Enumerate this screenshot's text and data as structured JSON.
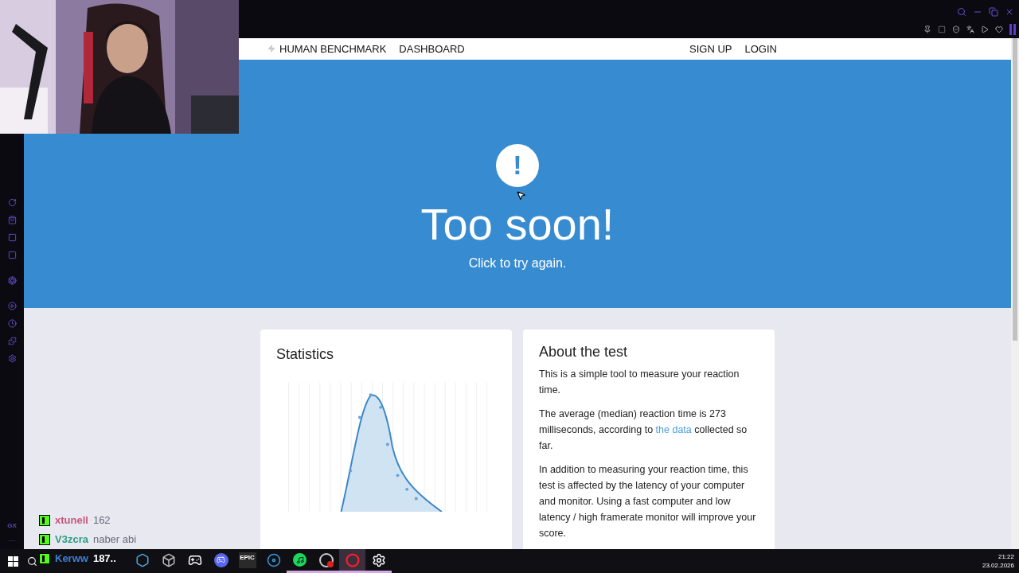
{
  "nav": {
    "brand": "HUMAN BENCHMARK",
    "links": [
      "DASHBOARD"
    ],
    "account": [
      "SIGN UP",
      "LOGIN"
    ]
  },
  "hero": {
    "icon": "!",
    "title": "Too soon!",
    "subtitle": "Click to try again."
  },
  "statistics": {
    "title": "Statistics"
  },
  "about": {
    "title": "About the test",
    "paragraphs": [
      {
        "text_before": "This is a simple tool to measure your reaction time."
      },
      {
        "text_before": "The average (median) reaction time is 273 milliseconds, according to ",
        "link": "the data",
        "text_after": " collected so far."
      },
      {
        "text_before": "In addition to measuring your reaction time, this test is affected by the latency of your computer and monitor. Using a fast computer and low latency / high framerate monitor will improve your score."
      }
    ]
  },
  "sidebar": {
    "bottom_label": "GX",
    "more": "···"
  },
  "chat": [
    {
      "user": "xtunell",
      "message": "162",
      "color": "#c9577b"
    },
    {
      "user": "V3zcra",
      "message": "naber abi",
      "color": "#2a9d80"
    },
    {
      "user": "Kerww",
      "message": "187..",
      "color": "#3d7fd6"
    }
  ],
  "taskbar": {
    "apps": [
      {
        "kind": "hex",
        "running": false,
        "selected": false
      },
      {
        "kind": "cube",
        "running": false,
        "selected": false
      },
      {
        "kind": "g",
        "running": false,
        "selected": false
      },
      {
        "kind": "discord",
        "running": false,
        "selected": false
      },
      {
        "kind": "epic",
        "running": false,
        "selected": false
      },
      {
        "kind": "steam",
        "running": false,
        "selected": false
      },
      {
        "kind": "spotify",
        "running": true,
        "selected": false
      },
      {
        "kind": "obs",
        "running": true,
        "selected": false
      },
      {
        "kind": "opera",
        "running": true,
        "selected": true
      },
      {
        "kind": "gear",
        "running": true,
        "selected": false
      }
    ],
    "epic_label": "EPIC",
    "time": "21:22",
    "date": "23.02.2026"
  }
}
